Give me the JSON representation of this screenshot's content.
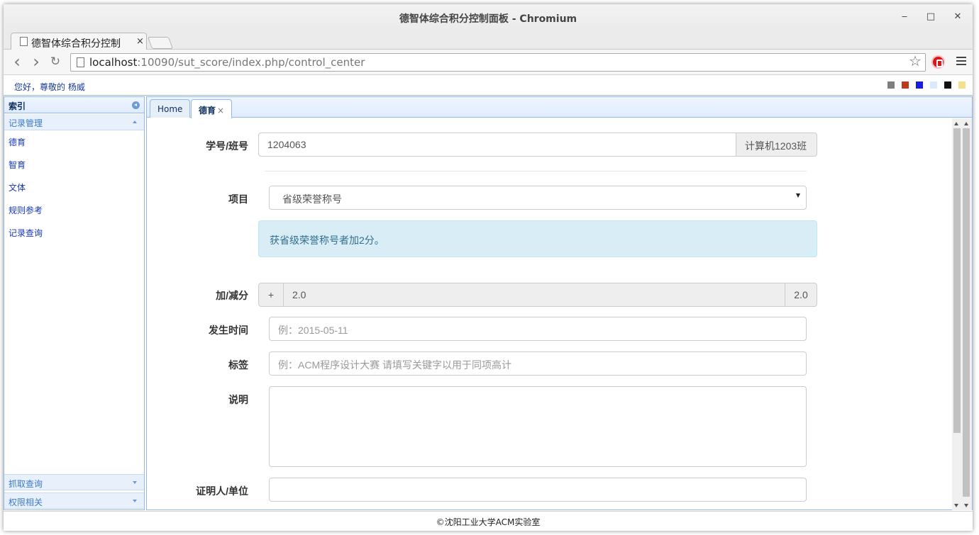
{
  "window": {
    "title": "德智体综合积分控制面板 - Chromium",
    "minimize_label": "‒",
    "maximize_label": "□",
    "close_label": "✕"
  },
  "browser": {
    "tab_title": "德智体综合积分控制",
    "tab_close": "×",
    "url_host": "localhost",
    "url_rest": ":10090/sut_score/index.php/control_center",
    "back_glyph": "‹",
    "forward_glyph": "›",
    "reload_glyph": "↻",
    "star_glyph": "☆"
  },
  "topbar": {
    "greeting": "您好，尊敬的 杨威",
    "swatch_colors": [
      "#7f7f7f",
      "#c0391a",
      "#1a1ae6",
      "#d9e9ff",
      "#111111",
      "#f5e08a"
    ]
  },
  "sidebar": {
    "header": "索引",
    "group_records": "记录管理",
    "links": [
      "德育",
      "智育",
      "文体",
      "规则参考",
      "记录查询"
    ],
    "group_fetch": "抓取查询",
    "group_perm": "权限相关"
  },
  "tabs": {
    "home": "Home",
    "moral": "德育",
    "close": "×"
  },
  "form": {
    "student_label": "学号/班号",
    "student_value": "1204063",
    "class_value": "计算机1203班",
    "item_label": "项目",
    "item_selected": "省级荣誉称号",
    "alert_text": "获省级荣誉称号者加2分。",
    "score_label": "加/减分",
    "score_sign": "+",
    "score_value": "2.0",
    "score_total": "2.0",
    "time_label": "发生时间",
    "time_placeholder": "例：2015-05-11",
    "tag_label": "标签",
    "tag_placeholder": "例：ACM程序设计大赛 请填写关键字以用于同项高计",
    "desc_label": "说明",
    "desc_value": "",
    "witness_label": "证明人/单位",
    "witness_value": ""
  },
  "footer": {
    "text": "©沈阳工业大学ACM实验室"
  }
}
